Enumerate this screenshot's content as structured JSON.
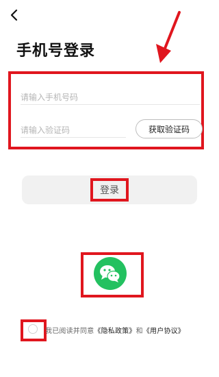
{
  "header": {
    "title": "手机号登录"
  },
  "form": {
    "phone_placeholder": "请输入手机号码",
    "code_placeholder": "请输入验证码",
    "get_code_label": "获取验证码"
  },
  "login": {
    "label": "登录"
  },
  "agreement": {
    "prefix": "我已阅读并同意",
    "privacy_link": "《隐私政策》",
    "conjunction": "和",
    "terms_link": "《用户协议》"
  },
  "colors": {
    "annotation_red": "#e0161e",
    "wechat_green": "#23c160",
    "login_bg": "#f1f1f1"
  },
  "icons": {
    "back": "chevron-left-icon",
    "wechat": "wechat-icon",
    "arrow": "arrow-down-left-icon"
  }
}
